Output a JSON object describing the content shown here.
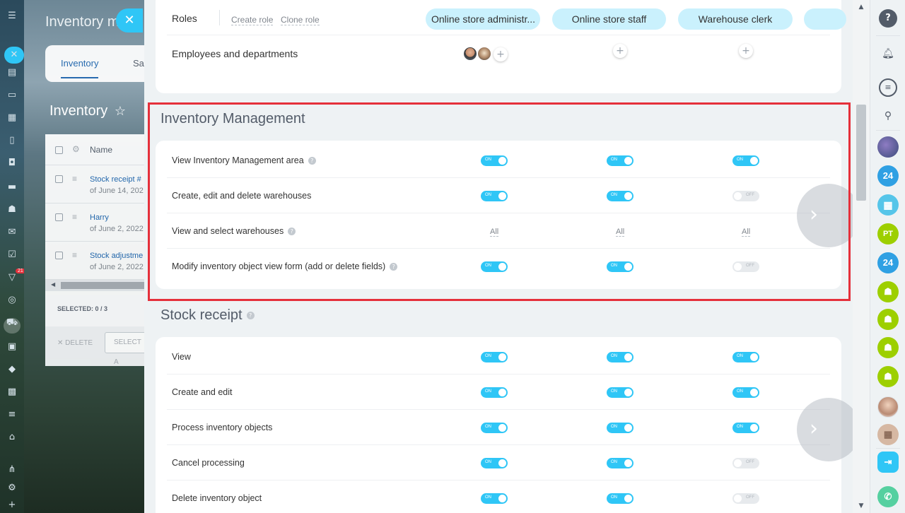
{
  "background": {
    "app_title": "Inventory m",
    "tabs": [
      "Inventory",
      "Sa"
    ],
    "page_heading": "Inventory",
    "grid": {
      "column_name": "Name",
      "rows": [
        {
          "link": "Stock receipt #",
          "sub": "of June 14, 202"
        },
        {
          "link": "Harry",
          "sub": "of June 2, 2022"
        },
        {
          "link": "Stock adjustme",
          "sub": "of June 2, 2022"
        }
      ],
      "selected_label": "SELECTED: 0 / 3",
      "delete_label": "DELETE",
      "select_action_label": "SELECT A"
    },
    "badge_count": "21"
  },
  "roles": {
    "label": "Roles",
    "create_role": "Create role",
    "clone_role": "Clone role",
    "pills": [
      "Online store administr...",
      "Online store staff",
      "Warehouse clerk"
    ],
    "employees_label": "Employees and departments"
  },
  "inventory_management": {
    "title": "Inventory Management",
    "rows": [
      {
        "label": "View Inventory Management area",
        "help": true,
        "values": [
          "on",
          "on",
          "on"
        ]
      },
      {
        "label": "Create, edit and delete warehouses",
        "help": false,
        "values": [
          "on",
          "on",
          "off"
        ]
      },
      {
        "label": "View and select warehouses",
        "help": true,
        "values": [
          "All",
          "All",
          "All"
        ]
      },
      {
        "label": "Modify inventory object view form (add or delete fields)",
        "help": true,
        "values": [
          "on",
          "on",
          "off"
        ]
      }
    ]
  },
  "stock_receipt": {
    "title": "Stock receipt",
    "rows": [
      {
        "label": "View",
        "values": [
          "on",
          "on",
          "on"
        ]
      },
      {
        "label": "Create and edit",
        "values": [
          "on",
          "on",
          "on"
        ]
      },
      {
        "label": "Process inventory objects",
        "values": [
          "on",
          "on",
          "on"
        ]
      },
      {
        "label": "Cancel processing",
        "values": [
          "on",
          "on",
          "off"
        ]
      },
      {
        "label": "Delete inventory object",
        "values": [
          "on",
          "on",
          "off"
        ]
      }
    ]
  },
  "toggle_text": {
    "on": "ON",
    "off": "OFF"
  },
  "rightbar": {
    "help": "?",
    "avatars": [
      "24",
      "PT",
      "24"
    ]
  },
  "colors": {
    "accent": "#2fc6f6",
    "pill": "#caf1fd",
    "highlight": "#e5303b",
    "group_green": "#9dcf00",
    "bitrix_blue": "#2fa0e3"
  }
}
